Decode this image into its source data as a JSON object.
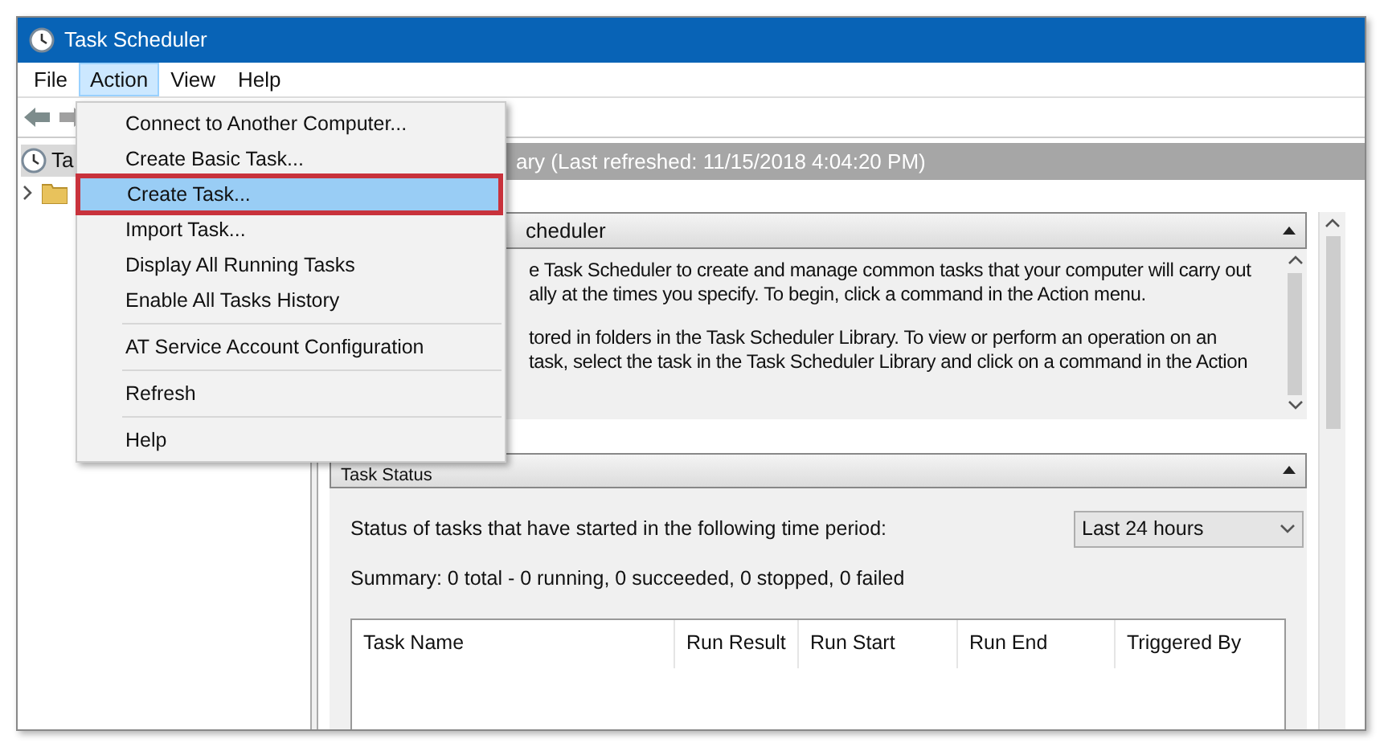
{
  "window": {
    "title": "Task Scheduler"
  },
  "menu_bar": [
    {
      "label": "File",
      "selected": false
    },
    {
      "label": "Action",
      "selected": true
    },
    {
      "label": "View",
      "selected": false
    },
    {
      "label": "Help",
      "selected": false
    }
  ],
  "tree": [
    {
      "label": "Ta",
      "kind": "clock"
    },
    {
      "kind": "folder",
      "expanded": false
    }
  ],
  "header": "ary (Last refreshed: 11/15/2018 4:04:20 PM)",
  "overview": {
    "title": "cheduler",
    "expanded": true,
    "paragraphs": [
      [
        "e Task Scheduler to create and manage common tasks that your computer will carry out",
        "ally at the times you specify. To begin, click a command in the Action menu."
      ],
      [
        "tored in folders in the Task Scheduler Library. To view or perform an operation on an",
        "task, select the task in the Task Scheduler Library and click on a command in the Action"
      ]
    ]
  },
  "task_status": {
    "title": "Task Status",
    "expanded": true,
    "period_label": "Status of tasks that have started in the following time period:",
    "period": "Last 24 hours",
    "summary": "Summary: 0 total - 0 running, 0 succeeded, 0 stopped, 0 failed",
    "columns": [
      "Task Name",
      "Run Result",
      "Run Start",
      "Run End",
      "Triggered By"
    ]
  },
  "action_menu": [
    {
      "kind": "item",
      "label": "Connect to Another Computer...",
      "selected": false
    },
    {
      "kind": "item",
      "label": "Create Basic Task...",
      "selected": false
    },
    {
      "kind": "item",
      "label": "Create Task...",
      "selected": true
    },
    {
      "kind": "item",
      "label": "Import Task...",
      "selected": false
    },
    {
      "kind": "item",
      "label": "Display All Running Tasks",
      "selected": false
    },
    {
      "kind": "item",
      "label": "Enable All Tasks History",
      "selected": false
    },
    {
      "kind": "separator"
    },
    {
      "kind": "item",
      "label": "AT Service Account Configuration",
      "selected": false
    },
    {
      "kind": "separator"
    },
    {
      "kind": "item",
      "label": "Refresh",
      "selected": false
    },
    {
      "kind": "separator"
    },
    {
      "kind": "item",
      "label": "Help",
      "selected": false
    }
  ]
}
